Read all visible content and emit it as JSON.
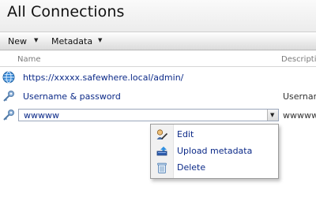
{
  "header": {
    "title": "All Connections"
  },
  "toolbar": {
    "new_label": "New",
    "metadata_label": "Metadata"
  },
  "columns": {
    "name": "Name",
    "description": "Descriptio"
  },
  "rows": [
    {
      "name": "https://xxxxx.safewhere.local/admin/",
      "description": "",
      "icon": "globe-icon"
    },
    {
      "name": "Username & password",
      "description": "Usernam",
      "icon": "key-icon"
    },
    {
      "name": "wwwww",
      "description": "wwwww",
      "icon": "key-icon",
      "editing": true
    }
  ],
  "context_menu": {
    "items": [
      {
        "label": "Edit",
        "icon": "edit-icon"
      },
      {
        "label": "Upload metadata",
        "icon": "upload-icon"
      },
      {
        "label": "Delete",
        "icon": "trash-icon"
      }
    ]
  },
  "colors": {
    "link_text": "#0c2a88",
    "border": "#9b9b9b"
  }
}
